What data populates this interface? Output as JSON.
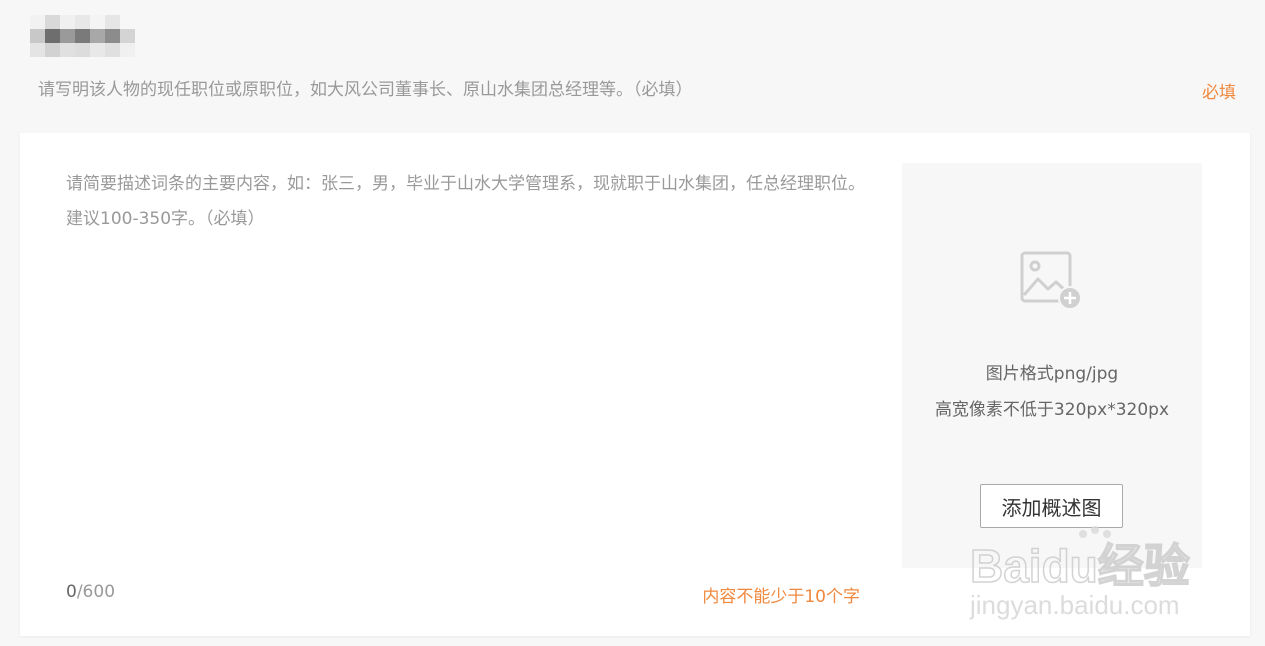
{
  "position": {
    "placeholder": "请写明该人物的现任职位或原职位，如大风公司董事长、原山水集团总经理等。（必填）",
    "required_label": "必填"
  },
  "summary": {
    "placeholder": "请简要描述词条的主要内容，如：张三，男，毕业于山水大学管理系，现就职于山水集团，任总经理职位。建议100-350字。（必填）",
    "count_current": "0",
    "count_max": "/600",
    "error": "内容不能少于10个字"
  },
  "image_panel": {
    "icon": "image-add-icon",
    "format_hint": "图片格式png/jpg",
    "size_hint": "高宽像素不低于320px*320px",
    "add_button": "添加概述图"
  },
  "watermark": {
    "logo": "Baidu经验",
    "url": "jingyan.baidu.com"
  },
  "colors": {
    "accent": "#f0883e",
    "page_bg": "#f7f7f7",
    "card_bg": "#ffffff",
    "placeholder": "#999999"
  }
}
